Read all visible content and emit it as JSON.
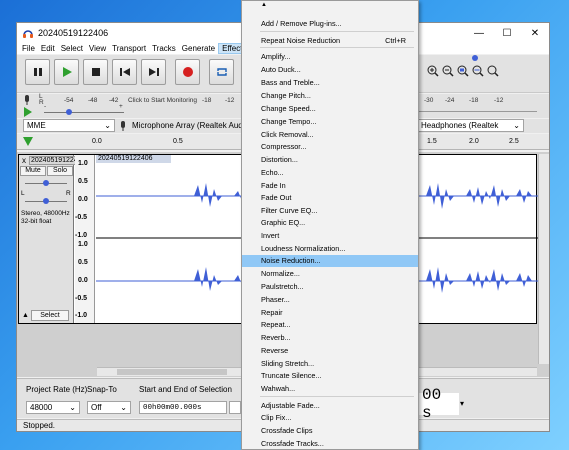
{
  "window": {
    "title": "20240519122406"
  },
  "menubar": [
    "File",
    "Edit",
    "Select",
    "View",
    "Transport",
    "Tracks",
    "Generate",
    "Effect"
  ],
  "meter": {
    "rec_ticks": [
      "-54",
      "-48",
      "-42"
    ],
    "monitor_label": "Click to Start Monitoring",
    "rec_ticks2": [
      "-18",
      "-12"
    ],
    "play_ticks": [
      "-30",
      "-24",
      "-18",
      "-12"
    ],
    "rec_lr": "L\nR",
    "gain_minus": "-",
    "gain_plus": "+"
  },
  "devices": {
    "host": "MME",
    "input": "Microphone Array (Realtek Audio",
    "output": "Headphones (Realtek"
  },
  "ruler": [
    "0.0",
    "0.5",
    "1.5",
    "2.0",
    "2.5"
  ],
  "track": {
    "name": "20240519122406",
    "clip_name": "20240519122406",
    "mute": "Mute",
    "solo": "Solo",
    "l": "L",
    "r": "R",
    "info": "Stereo, 48000Hz\n32-bit float",
    "select": "Select",
    "close": "x",
    "collapse": "▲",
    "scale_top": [
      "1.0",
      "0.5",
      "0.0",
      "-0.5",
      "-1.0"
    ],
    "scale_bottom": [
      "1.0",
      "0.5",
      "0.0",
      "-0.5",
      "-1.0"
    ]
  },
  "selection_bar": {
    "rate_label": "Project Rate (Hz)",
    "rate_value": "48000",
    "snap_label": "Snap-To",
    "snap_value": "Off",
    "sel_label": "Start and End of Selection",
    "start_time": "00h00m00.000s",
    "time_big": "00 s"
  },
  "status": "Stopped.",
  "effect_menu": {
    "scroll_up": "▲",
    "items": [
      {
        "label": "Add / Remove Plug-ins..."
      },
      {
        "label": "Repeat Noise Reduction",
        "shortcut": "Ctrl+R"
      },
      {
        "label": "Amplify..."
      },
      {
        "label": "Auto Duck..."
      },
      {
        "label": "Bass and Treble..."
      },
      {
        "label": "Change Pitch..."
      },
      {
        "label": "Change Speed..."
      },
      {
        "label": "Change Tempo..."
      },
      {
        "label": "Click Removal..."
      },
      {
        "label": "Compressor..."
      },
      {
        "label": "Distortion..."
      },
      {
        "label": "Echo..."
      },
      {
        "label": "Fade In"
      },
      {
        "label": "Fade Out"
      },
      {
        "label": "Filter Curve EQ..."
      },
      {
        "label": "Graphic EQ..."
      },
      {
        "label": "Invert"
      },
      {
        "label": "Loudness Normalization..."
      },
      {
        "label": "Noise Reduction...",
        "highlighted": true
      },
      {
        "label": "Normalize..."
      },
      {
        "label": "Paulstretch..."
      },
      {
        "label": "Phaser..."
      },
      {
        "label": "Repair"
      },
      {
        "label": "Repeat..."
      },
      {
        "label": "Reverb..."
      },
      {
        "label": "Reverse"
      },
      {
        "label": "Sliding Stretch..."
      },
      {
        "label": "Truncate Silence..."
      },
      {
        "label": "Wahwah..."
      },
      {
        "label": "Adjustable Fade..."
      },
      {
        "label": "Clip Fix..."
      },
      {
        "label": "Crossfade Clips"
      },
      {
        "label": "Crossfade Tracks..."
      }
    ]
  },
  "colors": {
    "accent": "#90c8f6",
    "waveform": "#3f5fd6",
    "record": "#d62020",
    "play": "#2fa02f"
  }
}
